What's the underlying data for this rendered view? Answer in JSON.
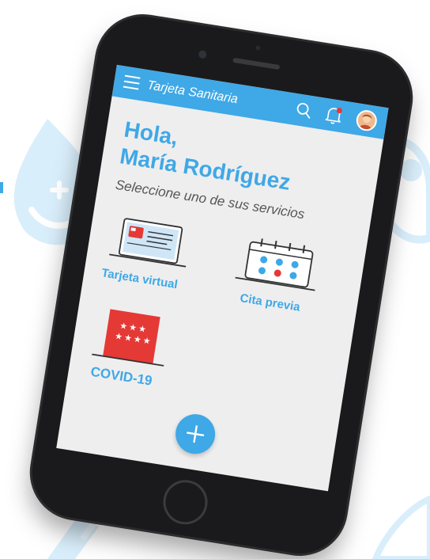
{
  "app_bar": {
    "title": "Tarjeta Sanitaria",
    "menu_icon": "hamburger-menu-icon",
    "search_icon": "search-icon",
    "notifications_icon": "bell-icon",
    "avatar_icon": "user-avatar",
    "background_color": "#3fa8e6"
  },
  "greeting": {
    "line1": "Hola,",
    "line2": "María Rodríguez"
  },
  "subtitle": "Seleccione uno de sus servicios",
  "services": [
    {
      "label": "Tarjeta virtual",
      "icon": "health-card-icon"
    },
    {
      "label": "Cita previa",
      "icon": "calendar-icon"
    },
    {
      "label": "COVID-19",
      "icon": "madrid-flag-icon"
    }
  ],
  "fab": {
    "icon": "plus-icon"
  },
  "colors": {
    "accent": "#3fa8e6",
    "flag_red": "#e53935",
    "screen_background": "#eeeeef"
  }
}
